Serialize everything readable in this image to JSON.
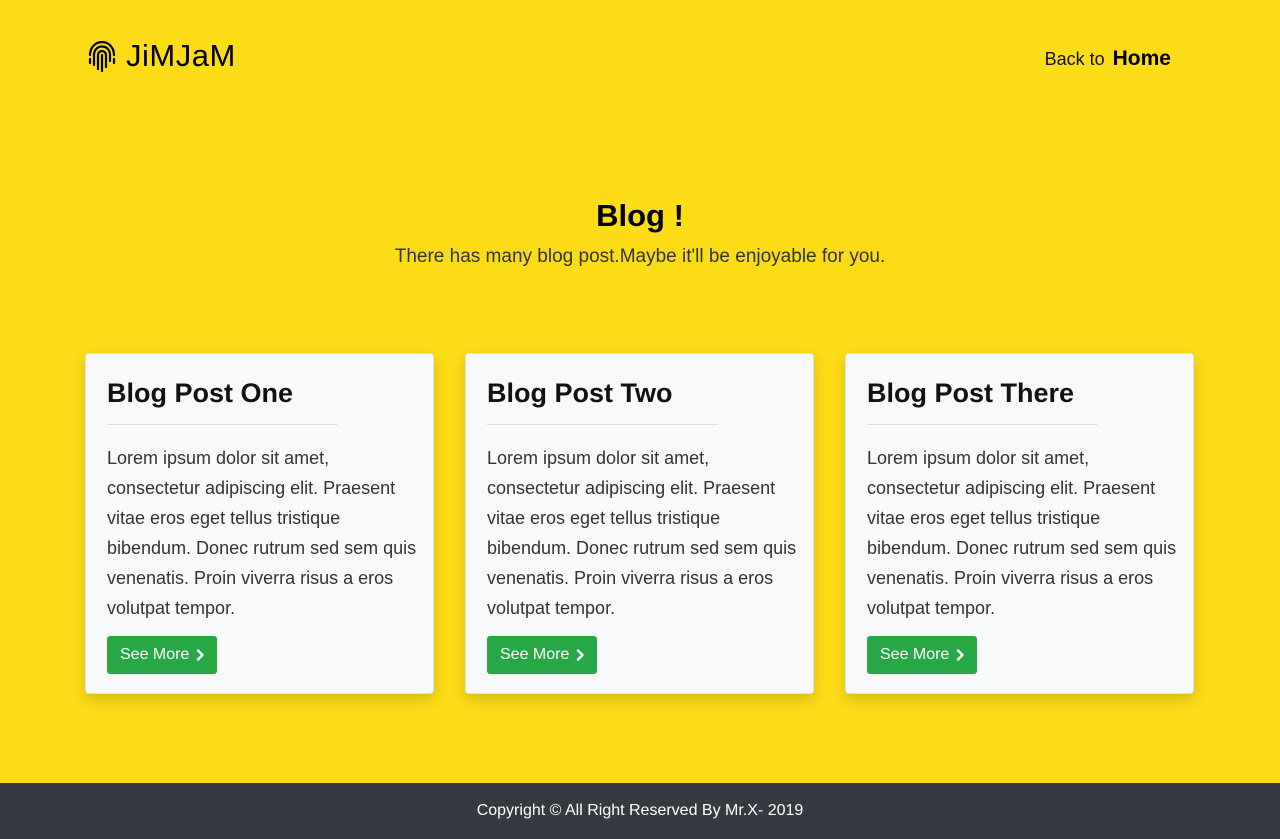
{
  "navbar": {
    "brand_icon": "fingerprint-icon",
    "brand_name": "JiMJaM",
    "back_text": "Back to",
    "home_link": "Home"
  },
  "hero": {
    "title": "Blog !",
    "subtitle": "There has many blog post.Maybe it'll be enjoyable for you."
  },
  "posts": [
    {
      "title": "Blog Post One",
      "body": "Lorem ipsum dolor sit amet, consectetur adipiscing elit. Praesent vitae eros eget tellus tristique bibendum. Donec rutrum sed sem quis venenatis. Proin viverra risus a eros volutpat tempor.",
      "button_label": "See More",
      "button_icon": "chevron-right-icon"
    },
    {
      "title": "Blog Post Two",
      "body": "Lorem ipsum dolor sit amet, consectetur adipiscing elit. Praesent vitae eros eget tellus tristique bibendum. Donec rutrum sed sem quis venenatis. Proin viverra risus a eros volutpat tempor.",
      "button_label": "See More",
      "button_icon": "chevron-right-icon"
    },
    {
      "title": "Blog Post There",
      "body": "Lorem ipsum dolor sit amet, consectetur adipiscing elit. Praesent vitae eros eget tellus tristique bibendum. Donec rutrum sed sem quis venenatis. Proin viverra risus a eros volutpat tempor.",
      "button_label": "See More",
      "button_icon": "chevron-right-icon"
    }
  ],
  "footer": {
    "copyright": "Copyright © All Right Reserved By Mr.X- 2019"
  },
  "colors": {
    "page_background": "#fcdc17",
    "card_background": "#f8f9fa",
    "button_green": "#28a745",
    "footer_background": "#343a40"
  }
}
